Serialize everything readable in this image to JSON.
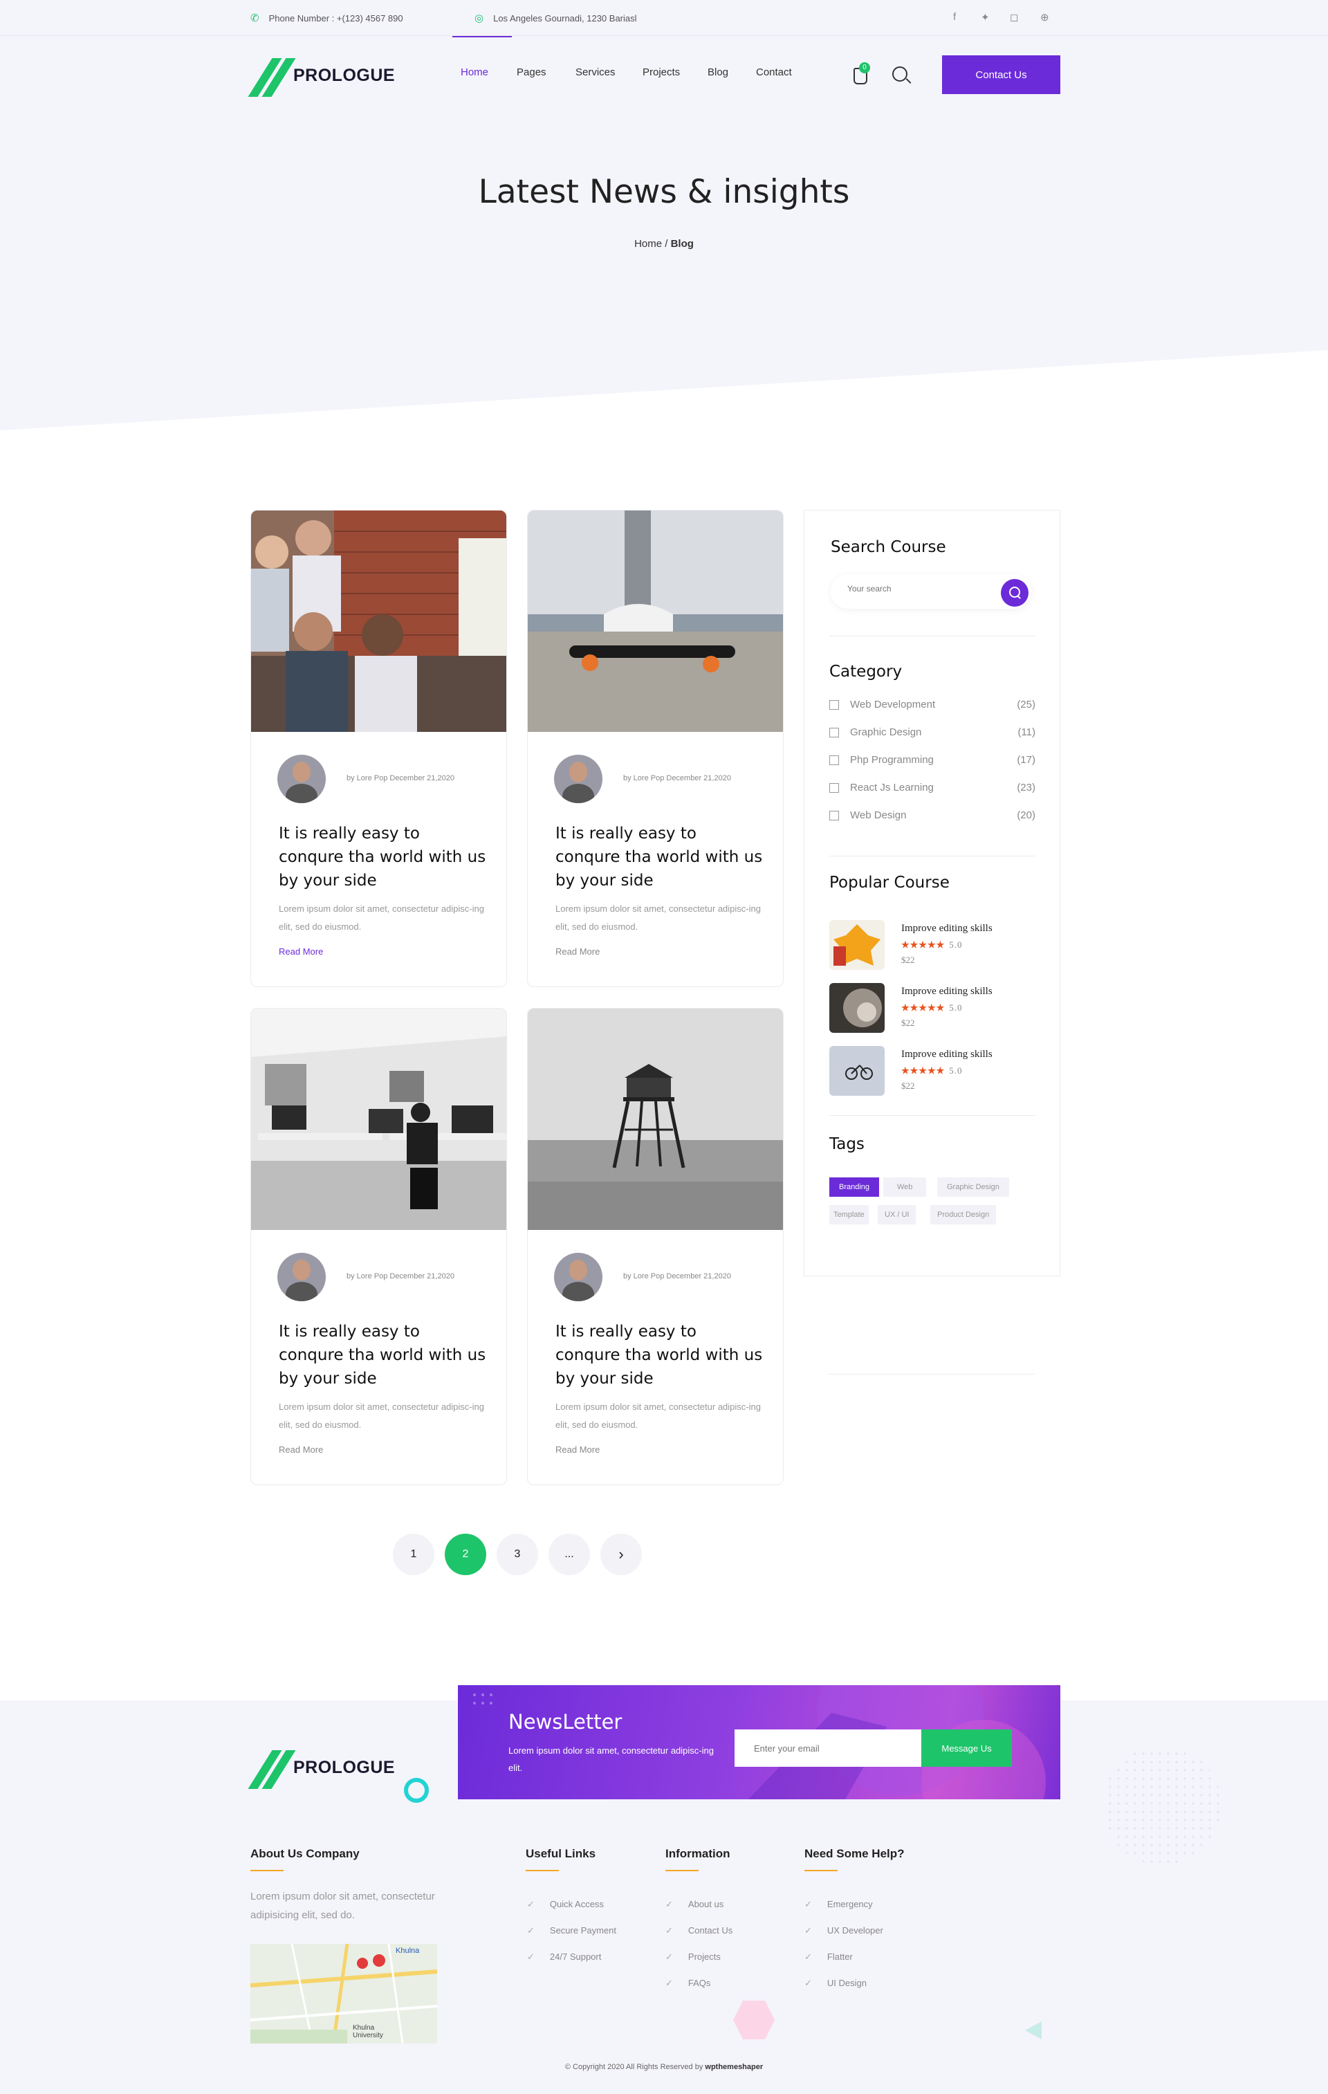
{
  "topbar": {
    "phone": "Phone Number : +(123) 4567 890",
    "address": "Los Angeles Gournadi, 1230 Bariasl",
    "social": [
      "facebook-icon",
      "twitter-icon",
      "instagram-icon",
      "dribbble-icon"
    ]
  },
  "brand": {
    "name": "PROLOGUE",
    "accent": "#6c2bd9",
    "green": "#1ec46a"
  },
  "nav": {
    "items": [
      "Home",
      "Pages",
      "Services",
      "Projects",
      "Blog",
      "Contact"
    ],
    "active": "Home",
    "cart_count": "0",
    "contact_label": "Contact Us"
  },
  "hero": {
    "title": "Latest News & insights",
    "breadcrumb_home": "Home",
    "breadcrumb_sep": "/",
    "breadcrumb_current": "Blog"
  },
  "posts": [
    {
      "meta": "by Lore Pop December 21,2020",
      "title": "It is really easy to conqure tha world with us by your side",
      "excerpt": "Lorem ipsum dolor sit amet, consectetur adipisc-ing elit, sed do eiusmod.",
      "more": "Read More",
      "image": "team-meeting-photo"
    },
    {
      "meta": "by Lore Pop December 21,2020",
      "title": "It is really easy to conqure tha world with us by your side",
      "excerpt": "Lorem ipsum dolor sit amet, consectetur adipisc-ing elit, sed do eiusmod.",
      "more": "Read More",
      "image": "skateboard-photo"
    },
    {
      "meta": "by Lore Pop December 21,2020",
      "title": "It is really easy to conqure tha world with us by your side",
      "excerpt": "Lorem ipsum dolor sit amet, consectetur adipisc-ing elit, sed do eiusmod.",
      "more": "Read More",
      "image": "office-desk-photo"
    },
    {
      "meta": "by Lore Pop December 21,2020",
      "title": "It is really easy to conqure tha world with us by your side",
      "excerpt": "Lorem ipsum dolor sit amet, consectetur adipisc-ing elit, sed do eiusmod.",
      "more": "Read More",
      "image": "lighthouse-photo"
    }
  ],
  "pagination": {
    "pages": [
      "1",
      "2",
      "3",
      "..."
    ],
    "current": "2",
    "next": "›"
  },
  "sidebar": {
    "search_title": "Search Course",
    "search_placeholder": "Your search",
    "category_title": "Category",
    "categories": [
      {
        "label": "Web Development",
        "count": "(25)"
      },
      {
        "label": "Graphic Design",
        "count": "(11)"
      },
      {
        "label": "Php Programming",
        "count": "(17)"
      },
      {
        "label": "React Js Learning",
        "count": "(23)"
      },
      {
        "label": "Web Design",
        "count": "(20)"
      }
    ],
    "popular_title": "Popular Course",
    "courses": [
      {
        "title": "Improve editing skills",
        "stars": "★★★★★",
        "rating": "5.0",
        "price": "$22"
      },
      {
        "title": "Improve editing skills",
        "stars": "★★★★★",
        "rating": "5.0",
        "price": "$22"
      },
      {
        "title": "Improve editing skills",
        "stars": "★★★★★",
        "rating": "5.0",
        "price": "$22"
      }
    ],
    "tags_title": "Tags",
    "tags": [
      "Branding",
      "Web",
      "Graphic Design",
      "Template",
      "UX / UI",
      "Product Design"
    ]
  },
  "newsletter": {
    "title": "NewsLetter",
    "text": "Lorem ipsum dolor sit amet, consectetur adipisc-ing elit.",
    "placeholder": "Enter your email",
    "button": "Message Us"
  },
  "footer": {
    "about_title": "About Us Company",
    "about_text": "Lorem ipsum dolor sit amet, consectetur adipisicing elit, sed do.",
    "useful_title": "Useful Links",
    "useful": [
      "Quick Access",
      "Secure Payment",
      "24/7 Support"
    ],
    "info_title": "Information",
    "info": [
      "About us",
      "Contact Us",
      "Projects",
      "FAQs"
    ],
    "help_title": "Need Some Help?",
    "help": [
      "Emergency",
      "UX Developer",
      "Flatter",
      "UI Design"
    ],
    "map_labels": [
      "Khulna",
      "Khulna University"
    ],
    "copyright": "© Copyright 2020 All Rights Reserved by ",
    "copyright_brand": "wpthemeshaper"
  }
}
